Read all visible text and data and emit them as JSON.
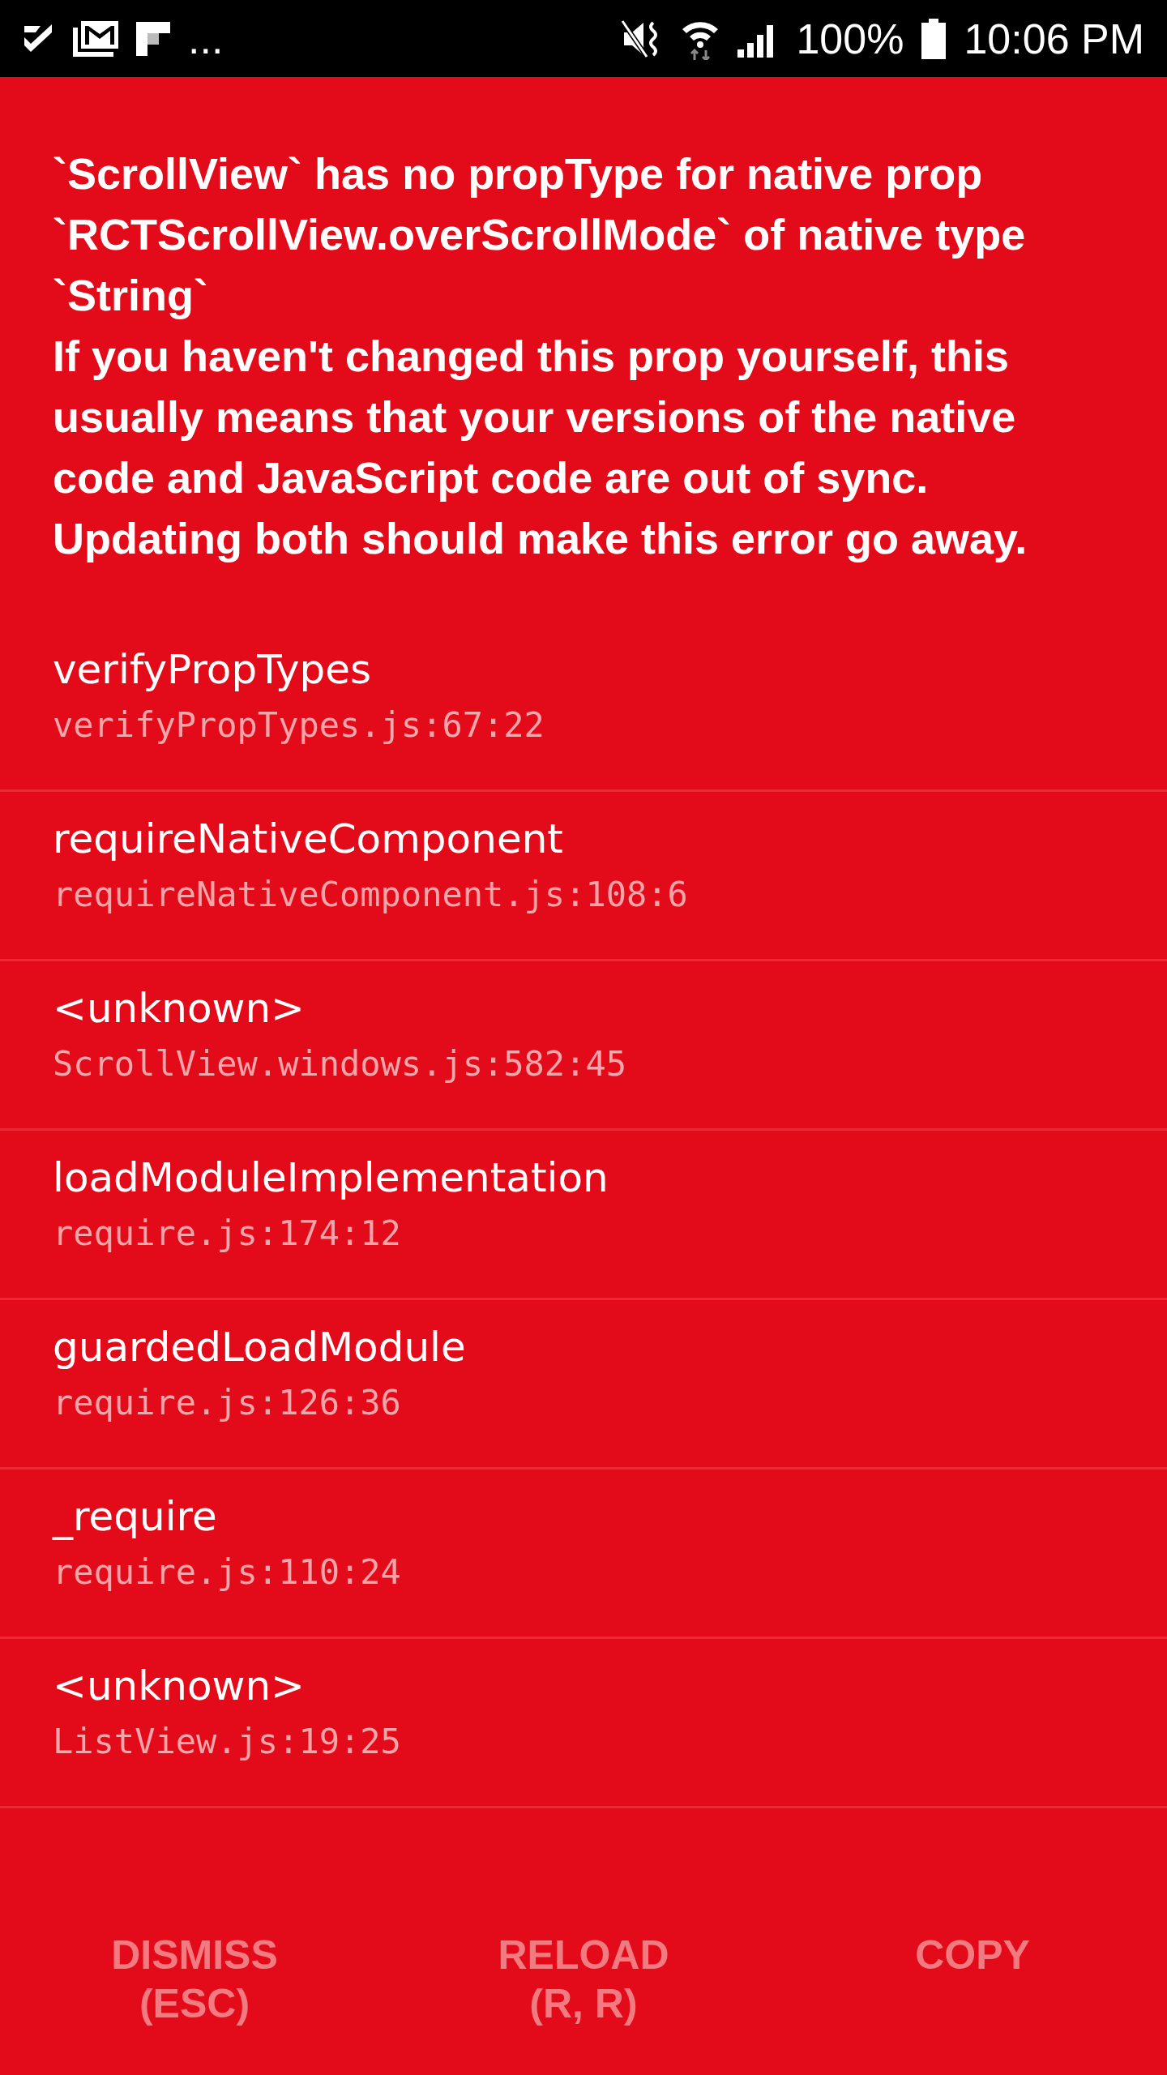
{
  "status_bar": {
    "overflow": "...",
    "battery": "100%",
    "time": "10:06 PM"
  },
  "error": {
    "message": "`ScrollView` has no propType for native prop `RCTScrollView.overScrollMode` of native type `String`\nIf you haven't changed this prop yourself, this usually means that your versions of the native code and JavaScript code are out of sync. Updating both should make this error go away."
  },
  "stack": [
    {
      "method": "verifyPropTypes",
      "location": "verifyPropTypes.js:67:22"
    },
    {
      "method": "requireNativeComponent",
      "location": "requireNativeComponent.js:108:6"
    },
    {
      "method": "<unknown>",
      "location": "ScrollView.windows.js:582:45"
    },
    {
      "method": "loadModuleImplementation",
      "location": "require.js:174:12"
    },
    {
      "method": "guardedLoadModule",
      "location": "require.js:126:36"
    },
    {
      "method": "_require",
      "location": "require.js:110:24"
    },
    {
      "method": "<unknown>",
      "location": "ListView.js:19:25"
    }
  ],
  "buttons": [
    "DISMISS\n(ESC)",
    "RELOAD\n(R, R)",
    "COPY"
  ]
}
